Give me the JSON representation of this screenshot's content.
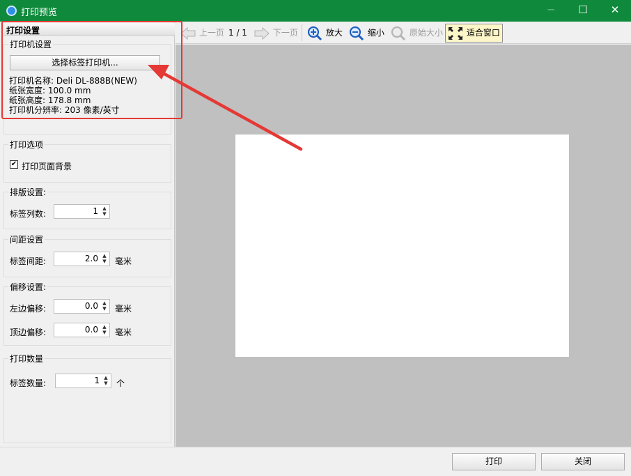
{
  "window": {
    "title": "打印预览",
    "minimize": "─",
    "maximize": "☐",
    "close": "✕"
  },
  "left_panel": {
    "header": "打印设置",
    "printer_group": {
      "title": "打印机设置",
      "select_button": "选择标签打印机...",
      "printer_name": "打印机名称: Deli DL-888B(NEW)",
      "paper_width": "纸张宽度: 100.0 mm",
      "paper_height": "纸张高度: 178.8 mm",
      "resolution": "打印机分辨率: 203 像素/英寸"
    },
    "print_options": {
      "title": "打印选项",
      "checkbox_label": "打印页面背景",
      "checked": true,
      "check_mark": "✔"
    },
    "layout": {
      "title": "排版设置:",
      "columns_label": "标签列数:",
      "columns_value": "1"
    },
    "spacing": {
      "title": "间距设置",
      "gap_label": "标签间距:",
      "gap_value": "2.0",
      "unit": "毫米"
    },
    "offset": {
      "title": "偏移设置:",
      "left_label": "左边偏移:",
      "left_value": "0.0",
      "top_label": "顶边偏移:",
      "top_value": "0.0",
      "unit": "毫米"
    },
    "quantity": {
      "title": "打印数量",
      "count_label": "标签数量:",
      "count_value": "1",
      "unit": "个"
    }
  },
  "toolbar": {
    "prev_page": "上一页",
    "page_indicator": "1 / 1",
    "next_page": "下一页",
    "zoom_in": "放大",
    "zoom_out": "缩小",
    "actual_size": "原始大小",
    "fit_window": "适合窗口"
  },
  "footer": {
    "print": "打印",
    "close": "关闭"
  },
  "spin_arrows": "▲\n▼",
  "colors": {
    "titlebar": "#0f8a3c",
    "preview_bg": "#c0c0c0",
    "annotation": "#e53935",
    "fit_highlight": "#fdf6c8"
  }
}
